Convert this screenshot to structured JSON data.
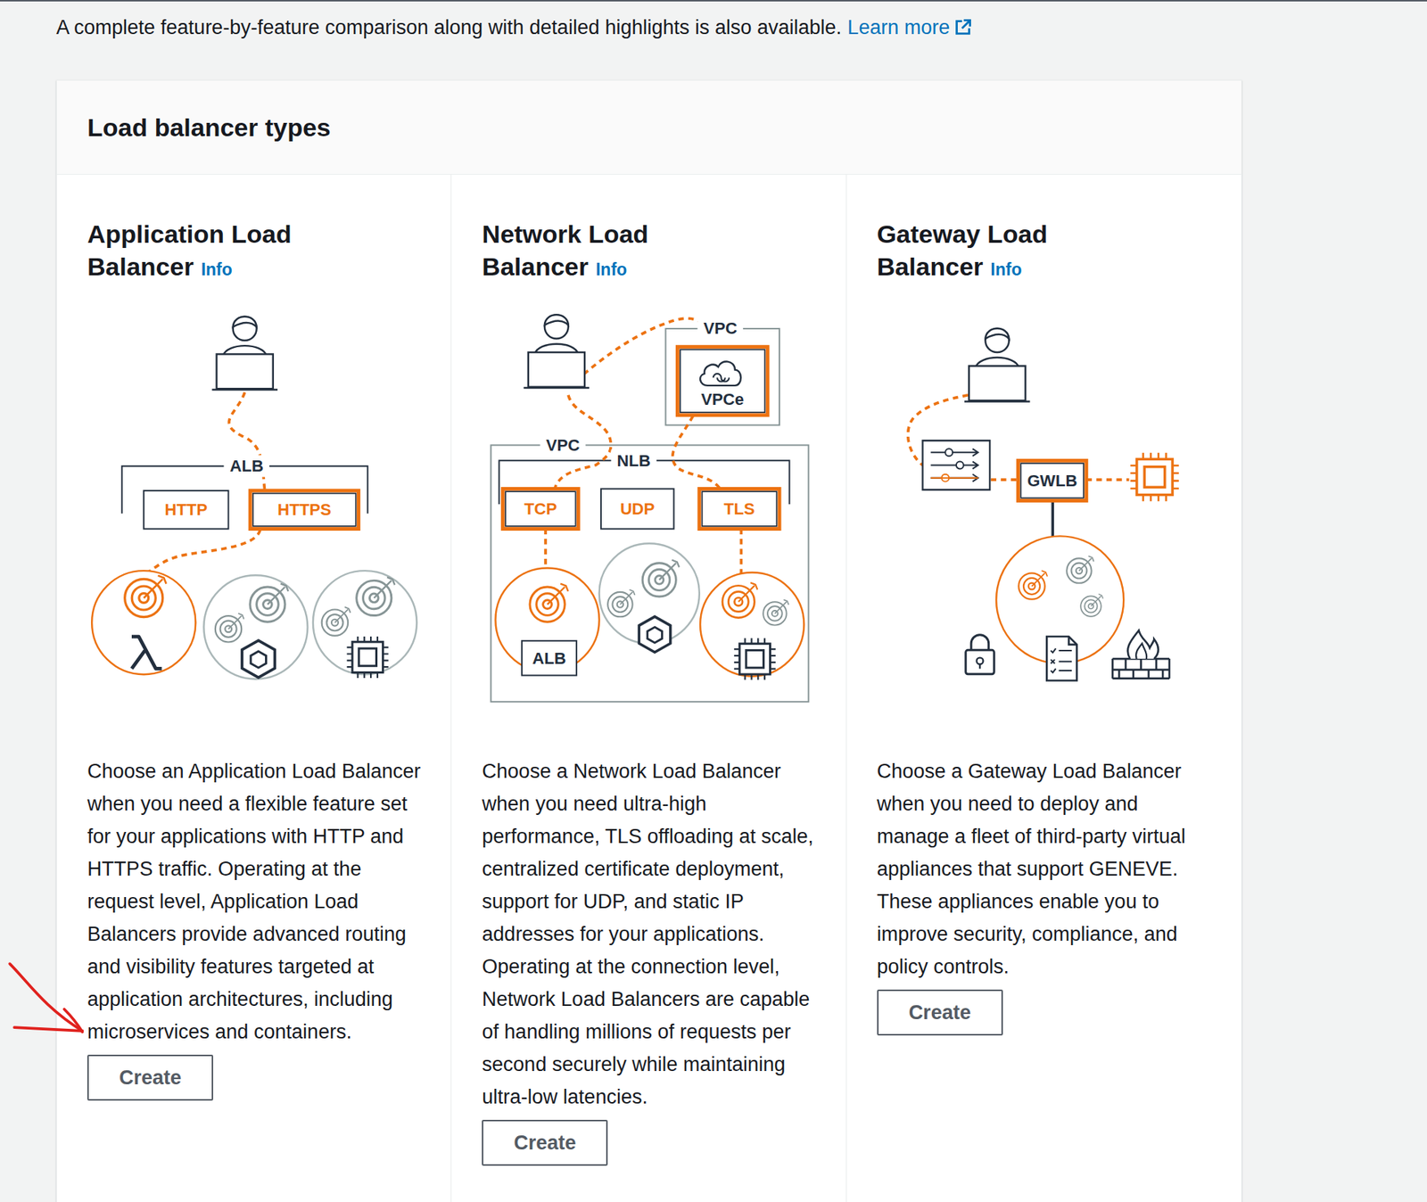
{
  "intro": {
    "text": "A complete feature-by-feature comparison along with detailed highlights is also available.",
    "link": "Learn more"
  },
  "panel": {
    "title": "Load balancer types"
  },
  "cards": [
    {
      "kind": "alb",
      "title": "Application Load Balancer",
      "info": "Info",
      "marked": true,
      "labels": [
        {
          "text": "ALB",
          "highlight": false
        },
        {
          "text": "HTTP",
          "highlight": false
        },
        {
          "text": "HTTPS",
          "highlight": true
        }
      ],
      "description": "Choose an Application Load Balancer when you need a flexible feature set for your applications with HTTP and HTTPS traffic. Operating at the request level, Application Load Balancers provide advanced routing and visibility features targeted at application architectures, including microservices and containers.",
      "button": "Create"
    },
    {
      "kind": "nlb",
      "title": "Network Load Balancer",
      "info": "Info",
      "marked": false,
      "labels": [
        {
          "text": "VPC",
          "highlight": false
        },
        {
          "text": "VPCe",
          "highlight": true
        },
        {
          "text": "VPC",
          "highlight": false
        },
        {
          "text": "NLB",
          "highlight": false
        },
        {
          "text": "TCP",
          "highlight": true
        },
        {
          "text": "UDP",
          "highlight": false
        },
        {
          "text": "TLS",
          "highlight": true
        },
        {
          "text": "ALB",
          "highlight": false
        }
      ],
      "description": "Choose a Network Load Balancer when you need ultra-high performance, TLS offloading at scale, centralized certificate deployment, support for UDP, and static IP addresses for your applications. Operating at the connection level, Network Load Balancers are capable of handling millions of requests per second securely while maintaining ultra-low latencies.",
      "button": "Create"
    },
    {
      "kind": "gwlb",
      "title": "Gateway Load Balancer",
      "info": "Info",
      "marked": false,
      "labels": [
        {
          "text": "GWLB",
          "highlight": true
        }
      ],
      "description": "Choose a Gateway Load Balancer when you need to deploy and manage a fleet of third-party virtual appliances that support GENEVE. These appliances enable you to improve security, compliance, and policy controls.",
      "button": "Create"
    }
  ]
}
